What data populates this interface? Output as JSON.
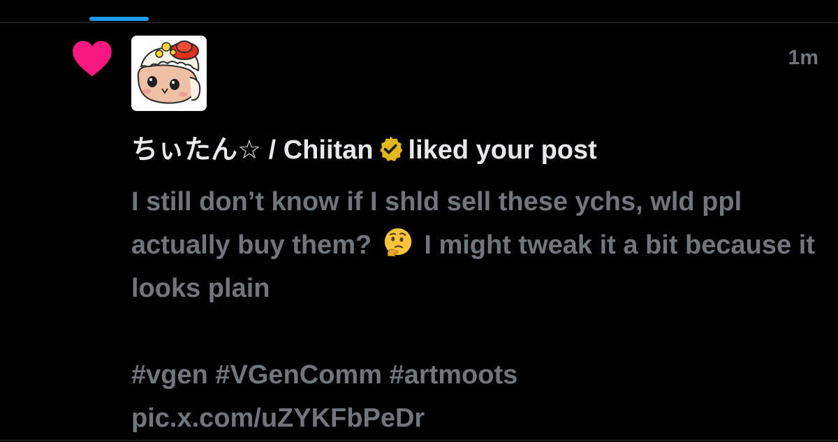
{
  "tabs": {
    "active_indicator_color": "#1d9bf0"
  },
  "notification": {
    "type_icon": "heart-icon",
    "type_color": "#f91880",
    "avatar_icon": "chiitan-avatar",
    "timestamp": "1m",
    "liker_name": "ちぃたん☆ / Chiitan",
    "verified_icon": "verified-badge-icon",
    "verified_color": "#e2b719",
    "action_text": "liked your post",
    "post_text_part1": "I still don’t know if I shld sell these ychs, wld ppl actually buy them?",
    "post_emoji": "thinking-face-emoji",
    "post_text_part2": "I might tweak it a bit because it looks plain",
    "hashtags_and_link": "#vgen #VGenComm #artmoots pic.x.com/uZYKFbPeDr"
  }
}
